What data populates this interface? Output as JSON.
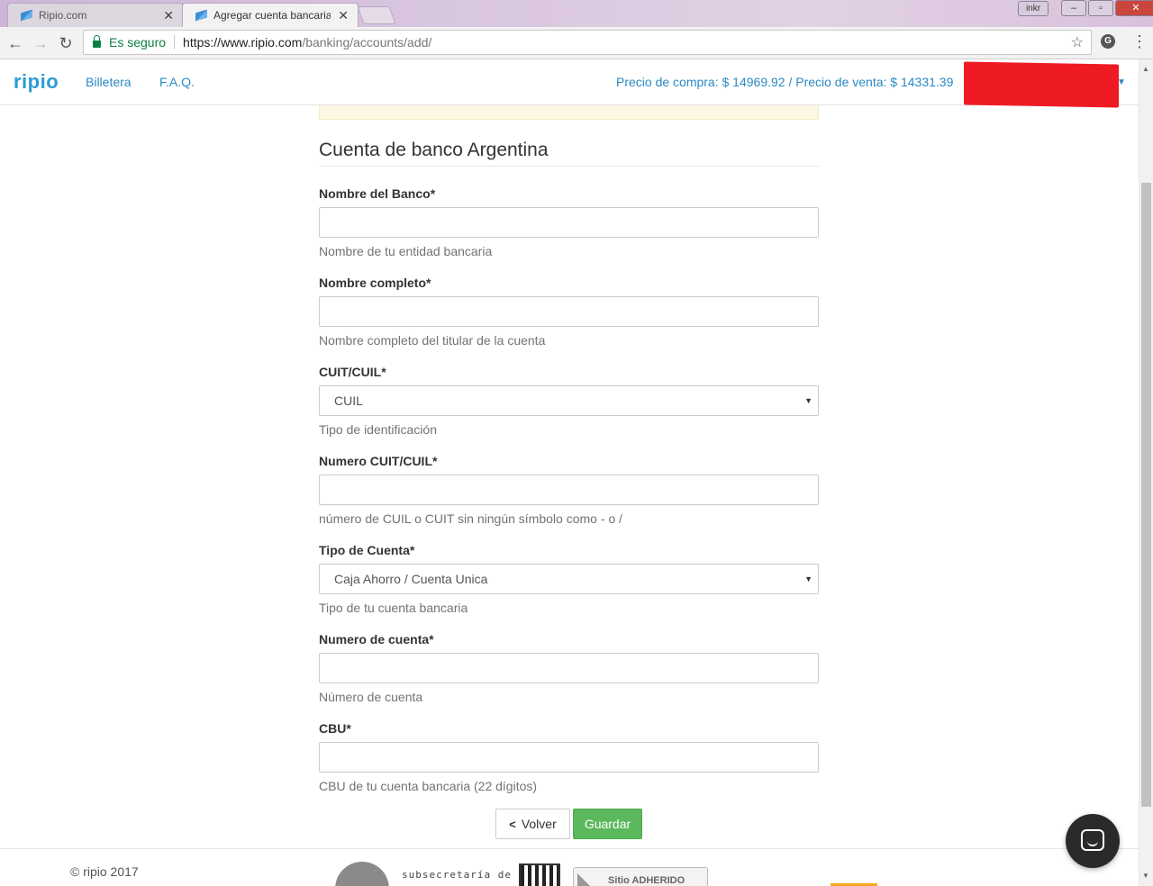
{
  "browser": {
    "tabs": [
      {
        "title": "Ripio.com",
        "active": false
      },
      {
        "title": "Agregar cuenta bancaria",
        "active": true
      }
    ],
    "close_glyph": "✕",
    "ext_label": "inkr",
    "secure_label": "Es seguro",
    "url_main": "https://www.ripio.com",
    "url_path": "/banking/accounts/add/",
    "ext_icon_letter": "G"
  },
  "header": {
    "logo": "ripio",
    "nav": [
      "Billetera",
      "F.A.Q."
    ],
    "prices": "Precio de compra: $ 14969.92  /  Precio de venta: $ 14331.39"
  },
  "form": {
    "title": "Cuenta de banco Argentina",
    "fields": [
      {
        "label": "Nombre del Banco*",
        "value": "",
        "help": "Nombre de tu entidad bancaria",
        "type": "text"
      },
      {
        "label": "Nombre completo*",
        "value": "",
        "help": "Nombre completo del titular de la cuenta",
        "type": "text"
      },
      {
        "label": "CUIT/CUIL*",
        "value": "CUIL",
        "help": "Tipo de identificación",
        "type": "select"
      },
      {
        "label": "Numero CUIT/CUIL*",
        "value": "",
        "help": "número de CUIL o CUIT sin ningún símbolo como - o /",
        "type": "text"
      },
      {
        "label": "Tipo de Cuenta*",
        "value": "Caja Ahorro / Cuenta Unica",
        "help": "Tipo de tu cuenta bancaria",
        "type": "select"
      },
      {
        "label": "Numero de cuenta*",
        "value": "",
        "help": "Número de cuenta",
        "type": "text"
      },
      {
        "label": "CBU*",
        "value": "",
        "help": "CBU de tu cuenta bancaria (22 dígitos)",
        "type": "text"
      }
    ],
    "back_label": "Volver",
    "save_label": "Guardar"
  },
  "footer": {
    "copyright": "© ripio 2017",
    "subsecretaria": "subsecretaría de",
    "adherido": "Sitio ADHERIDO"
  },
  "colors": {
    "brand": "#2b9bd6",
    "link": "#2b89c4",
    "success": "#5cb85c",
    "secure": "#0b8043"
  }
}
